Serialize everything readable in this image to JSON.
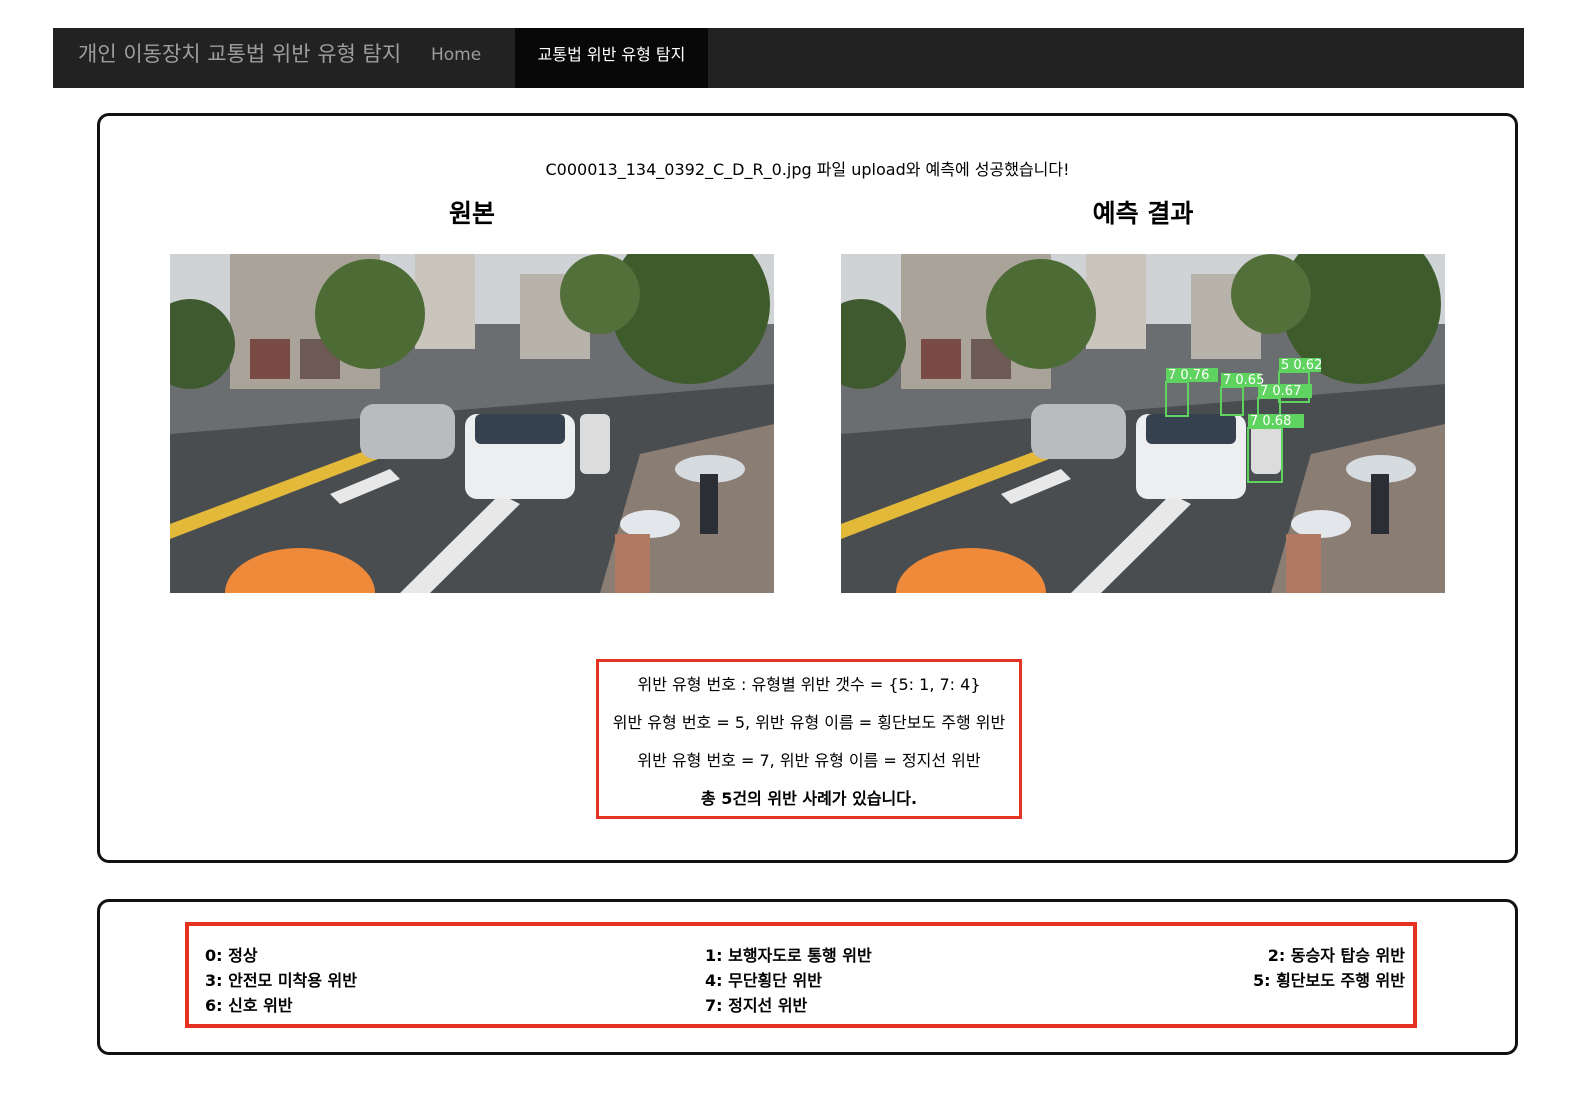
{
  "navbar": {
    "brand": "개인 이동장치 교통법 위반 유형 탐지",
    "home_label": "Home",
    "active_label": "교통법 위반 유형 탐지"
  },
  "result": {
    "success_message": "C000013_134_0392_C_D_R_0.jpg 파일 upload와 예측에 성공했습니다!",
    "original_title": "원본",
    "prediction_title": "예측 결과"
  },
  "detections": [
    {
      "label": "5  0.62"
    },
    {
      "label": "7  0.76"
    },
    {
      "label": "7  0.65"
    },
    {
      "label": "7  0.67"
    },
    {
      "label": "7  0.68"
    }
  ],
  "summary": {
    "counts_line": "위반 유형 번호 : 유형별 위반 갯수 = {5: 1, 7: 4}",
    "type5_line": "위반 유형 번호 = 5, 위반 유형 이름 = 횡단보도 주행 위반",
    "type7_line": "위반 유형 번호 = 7, 위반 유형 이름 = 정지선 위반",
    "total_line": "총 5건의 위반 사례가 있습니다."
  },
  "legend": [
    "0: 정상",
    "1: 보행자도로 통행 위반",
    "2: 동승자 탑승 위반",
    "3: 안전모 미착용 위반",
    "4: 무단횡단 위반",
    "5: 횡단보도 주행 위반",
    "6: 신호 위반",
    "7: 정지선 위반"
  ],
  "colors": {
    "navbar_bg": "#222222",
    "highlight_border": "#e53322",
    "detection_box": "#5fd35f"
  }
}
